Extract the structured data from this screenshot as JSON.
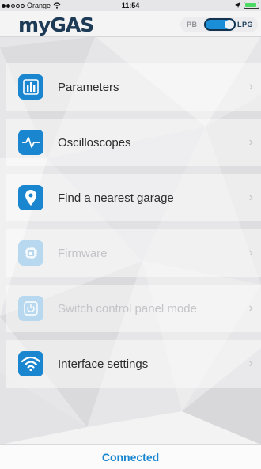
{
  "status_bar": {
    "carrier": "Orange",
    "time": "11:54"
  },
  "header": {
    "logo": "myGAS",
    "fuel_toggle": {
      "left_label": "PB",
      "right_label": "LPG",
      "selected": "LPG"
    }
  },
  "menu": {
    "items": [
      {
        "label": "Parameters",
        "icon": "bar-chart-icon",
        "enabled": true
      },
      {
        "label": "Oscilloscopes",
        "icon": "pulse-wave-icon",
        "enabled": true
      },
      {
        "label": "Find a nearest garage",
        "icon": "location-pin-icon",
        "enabled": true
      },
      {
        "label": "Firmware",
        "icon": "chip-icon",
        "enabled": false
      },
      {
        "label": "Switch control panel mode",
        "icon": "power-icon",
        "enabled": false
      },
      {
        "label": "Interface settings",
        "icon": "wifi-icon",
        "enabled": true
      }
    ],
    "chevron": "›"
  },
  "footer": {
    "connection_status": "Connected"
  },
  "colors": {
    "accent": "#1a86cf",
    "logo_dark": "#1d3a56",
    "battery": "#4cd964"
  }
}
